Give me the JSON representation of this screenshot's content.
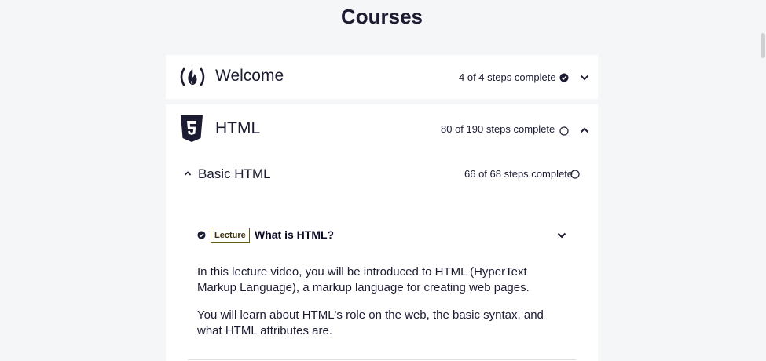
{
  "page": {
    "title": "Courses"
  },
  "blocks": [
    {
      "title": "Welcome",
      "steps_text": "4 of 4 steps complete",
      "complete": true,
      "expanded": false,
      "icon": "freecodecamp-flame-icon"
    },
    {
      "title": "HTML",
      "steps_text": "80 of 190 steps complete",
      "complete": false,
      "expanded": true,
      "icon": "html5-shield-icon",
      "sections": [
        {
          "title": "Basic HTML",
          "steps_text": "66 of 68 steps complete",
          "complete": false,
          "expanded": true,
          "lessons": [
            {
              "badge": "Lecture",
              "title": "What is HTML?",
              "complete": true,
              "paragraphs": [
                "In this lecture video, you will be introduced to HTML (HyperText Markup Language), a markup language for creating web pages.",
                "You will learn about HTML's role on the web, the basic syntax, and what HTML attributes are."
              ]
            }
          ]
        }
      ]
    }
  ],
  "colors": {
    "text": "#1b1b32",
    "background": "#f5f6f7",
    "card": "#ffffff",
    "badge_border": "#6b5a14"
  }
}
